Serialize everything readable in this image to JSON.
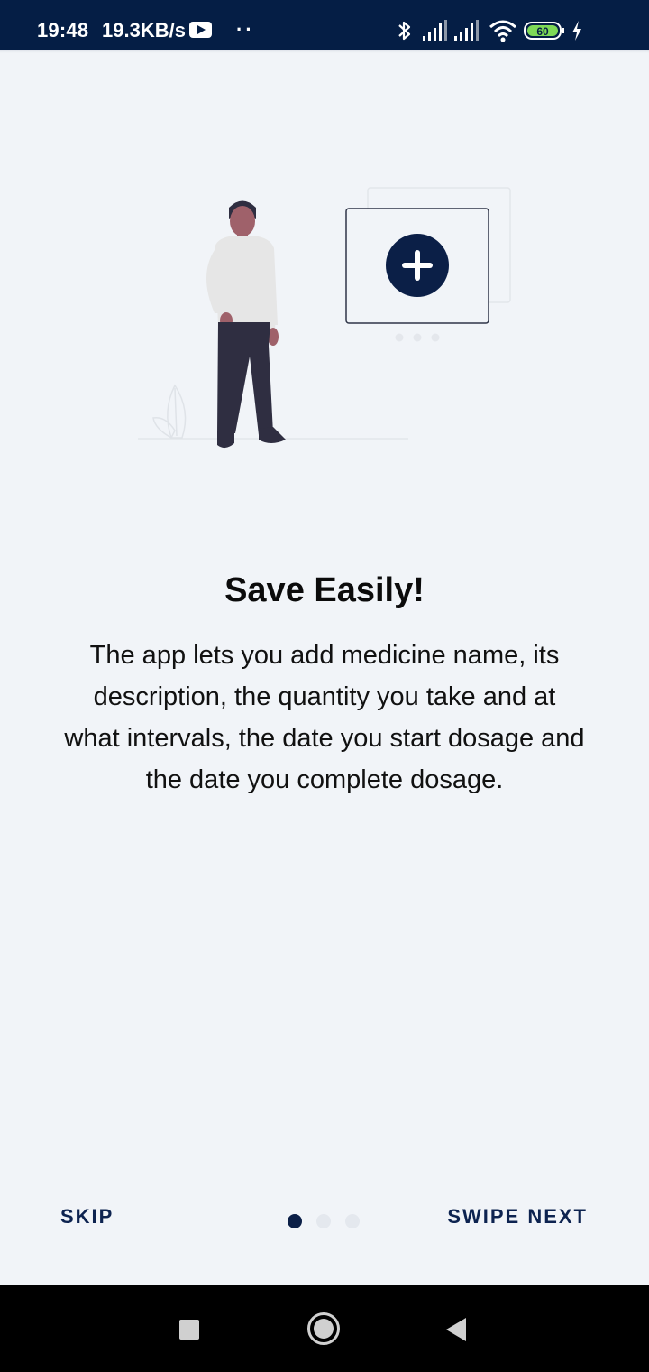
{
  "status_bar": {
    "time": "19:48",
    "network_speed": "19.3KB/s",
    "battery_level": "60",
    "icons": [
      "youtube-icon",
      "more-dots-icon",
      "bluetooth-icon",
      "signal-icon",
      "signal-icon",
      "wifi-icon",
      "battery-icon",
      "charging-icon"
    ]
  },
  "onboarding": {
    "title": "Save Easily!",
    "description": "The app lets you add medicine name, its description, the quantity you take and at what intervals, the date you start dosage and the date you complete dosage.",
    "illustration_icon": "add-plus-icon",
    "current_page": 1,
    "total_pages": 3
  },
  "footer": {
    "skip_label": "SKIP",
    "next_label": "SWIPE NEXT"
  },
  "navigation_bar": {
    "icons": [
      "recents-icon",
      "home-icon",
      "back-icon"
    ]
  },
  "colors": {
    "status_bar": "#051e45",
    "background": "#f1f4f8",
    "accent": "#0b1f47",
    "button_text": "#0d2350"
  }
}
